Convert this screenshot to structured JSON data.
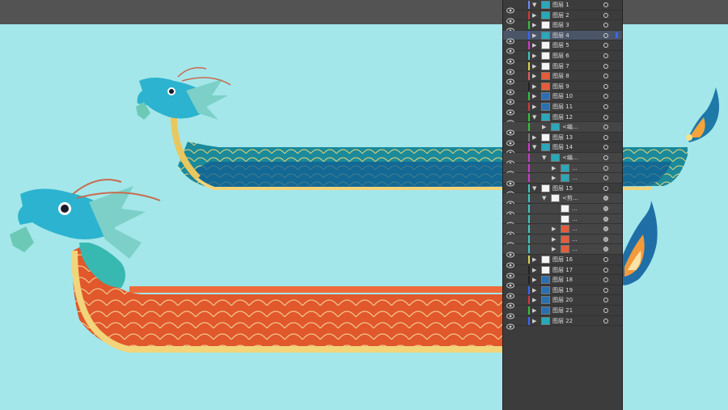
{
  "app": {
    "topbar_color": "#535353",
    "canvas_color": "#a3e7ea"
  },
  "layers_panel": {
    "rows": [
      {
        "name": "图层 1",
        "color": "#6b8cff",
        "arrow": "▼",
        "indent": 0,
        "thumb": "teal",
        "selected": false
      },
      {
        "name": "图层 2",
        "color": "#d23b3b",
        "arrow": "▶",
        "indent": 0,
        "thumb": "teal",
        "selected": false
      },
      {
        "name": "图层 3",
        "color": "#35c23b",
        "arrow": "▶",
        "indent": 0,
        "thumb": "white",
        "selected": false
      },
      {
        "name": "图层 4",
        "color": "#3a66ff",
        "arrow": "▶",
        "indent": 0,
        "thumb": "teal",
        "selected": true
      },
      {
        "name": "图层 5",
        "color": "#cf3acf",
        "arrow": "▶",
        "indent": 0,
        "thumb": "white",
        "selected": false
      },
      {
        "name": "图层 6",
        "color": "#3ec6c6",
        "arrow": "▶",
        "indent": 0,
        "thumb": "white",
        "selected": false
      },
      {
        "name": "图层 7",
        "color": "#d7d24a",
        "arrow": "▶",
        "indent": 0,
        "thumb": "white",
        "selected": false
      },
      {
        "name": "图层 8",
        "color": "#e06060",
        "arrow": "▶",
        "indent": 0,
        "thumb": "red",
        "selected": false
      },
      {
        "name": "图层 9",
        "color": "#222222",
        "arrow": "▶",
        "indent": 0,
        "thumb": "red",
        "selected": false
      },
      {
        "name": "图层 10",
        "color": "#35c23b",
        "arrow": "▶",
        "indent": 0,
        "thumb": "blue",
        "selected": false
      },
      {
        "name": "图层 11",
        "color": "#d23b3b",
        "arrow": "▶",
        "indent": 0,
        "thumb": "blue",
        "selected": false
      },
      {
        "name": "图层 12",
        "color": "#35c23b",
        "arrow": "▼",
        "indent": 0,
        "thumb": "teal",
        "selected": false
      },
      {
        "name": "<编...",
        "color": "#35c23b",
        "arrow": "▶",
        "indent": 1,
        "thumb": "teal",
        "selected": false,
        "sub": true
      },
      {
        "name": "图层 13",
        "color": "#7a7a7a",
        "arrow": "▶",
        "indent": 0,
        "thumb": "white",
        "selected": false
      },
      {
        "name": "图层 14",
        "color": "#cf3acf",
        "arrow": "▼",
        "indent": 0,
        "thumb": "teal",
        "selected": false
      },
      {
        "name": "<编...",
        "color": "#cf3acf",
        "arrow": "▼",
        "indent": 1,
        "thumb": "teal",
        "selected": false,
        "sub": true
      },
      {
        "name": "...",
        "color": "#cf3acf",
        "arrow": "▶",
        "indent": 2,
        "thumb": "teal",
        "selected": false,
        "sub": true
      },
      {
        "name": "...",
        "color": "#cf3acf",
        "arrow": "▶",
        "indent": 2,
        "thumb": "teal",
        "selected": false,
        "sub": true
      },
      {
        "name": "图层 15",
        "color": "#3ec6c6",
        "arrow": "▼",
        "indent": 0,
        "thumb": "white",
        "selected": false
      },
      {
        "name": "<剪...",
        "color": "#3ec6c6",
        "arrow": "▼",
        "indent": 1,
        "thumb": "white",
        "selected": false,
        "sub": true
      },
      {
        "name": "...",
        "color": "#3ec6c6",
        "arrow": "",
        "indent": 2,
        "thumb": "white",
        "selected": false,
        "sub": true
      },
      {
        "name": "...",
        "color": "#3ec6c6",
        "arrow": "",
        "indent": 2,
        "thumb": "white",
        "selected": false,
        "sub": true
      },
      {
        "name": "...",
        "color": "#3ec6c6",
        "arrow": "▶",
        "indent": 2,
        "thumb": "red",
        "selected": false,
        "sub": true
      },
      {
        "name": "...",
        "color": "#3ec6c6",
        "arrow": "▶",
        "indent": 2,
        "thumb": "red",
        "selected": false,
        "sub": true
      },
      {
        "name": "...",
        "color": "#3ec6c6",
        "arrow": "▶",
        "indent": 2,
        "thumb": "red",
        "selected": false,
        "sub": true
      },
      {
        "name": "图层 16",
        "color": "#d7d24a",
        "arrow": "▶",
        "indent": 0,
        "thumb": "white",
        "selected": false
      },
      {
        "name": "图层 17",
        "color": "#222222",
        "arrow": "▶",
        "indent": 0,
        "thumb": "white",
        "selected": false
      },
      {
        "name": "图层 18",
        "color": "#222222",
        "arrow": "▶",
        "indent": 0,
        "thumb": "blue",
        "selected": false
      },
      {
        "name": "图层 19",
        "color": "#3a66ff",
        "arrow": "▶",
        "indent": 0,
        "thumb": "blue",
        "selected": false
      },
      {
        "name": "图层 20",
        "color": "#d23b3b",
        "arrow": "▶",
        "indent": 0,
        "thumb": "blue",
        "selected": false
      },
      {
        "name": "图层 21",
        "color": "#35c23b",
        "arrow": "▶",
        "indent": 0,
        "thumb": "blue",
        "selected": false
      },
      {
        "name": "图层 22",
        "color": "#3a66ff",
        "arrow": "▶",
        "indent": 0,
        "thumb": "teal",
        "selected": false
      }
    ]
  }
}
